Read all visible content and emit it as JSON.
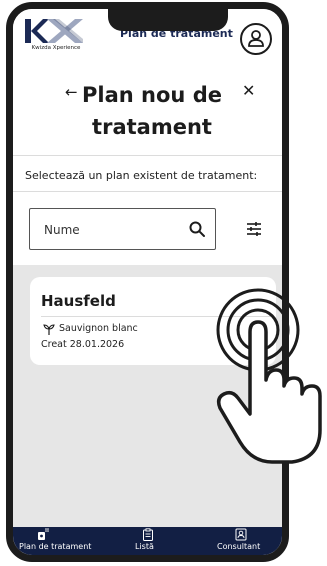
{
  "app": {
    "logo_text": "Kwizda Xperience",
    "title": "Plan de tratament"
  },
  "header": {
    "title": "Plan nou de tratament",
    "back_icon": "arrow-left-icon",
    "close_icon": "close-icon"
  },
  "subtitle": "Selectează un plan existent de tratament:",
  "search": {
    "placeholder": "Nume",
    "icon": "search-icon"
  },
  "filter_icon": "sliders-icon",
  "plans": [
    {
      "name": "Hausfeld",
      "variety": "Sauvignon blanc",
      "created": "Creat 28.01.2026"
    }
  ],
  "bottom_nav": [
    {
      "label": "Plan de tratament",
      "icon": "plan-icon",
      "active": true
    },
    {
      "label": "Listă",
      "icon": "clipboard-icon",
      "active": false
    },
    {
      "label": "Consultant",
      "icon": "consultant-icon",
      "active": false
    }
  ],
  "colors": {
    "nav_bg": "#121f44",
    "list_bg": "#e6e6e6",
    "title_dark": "#1c2a55"
  }
}
